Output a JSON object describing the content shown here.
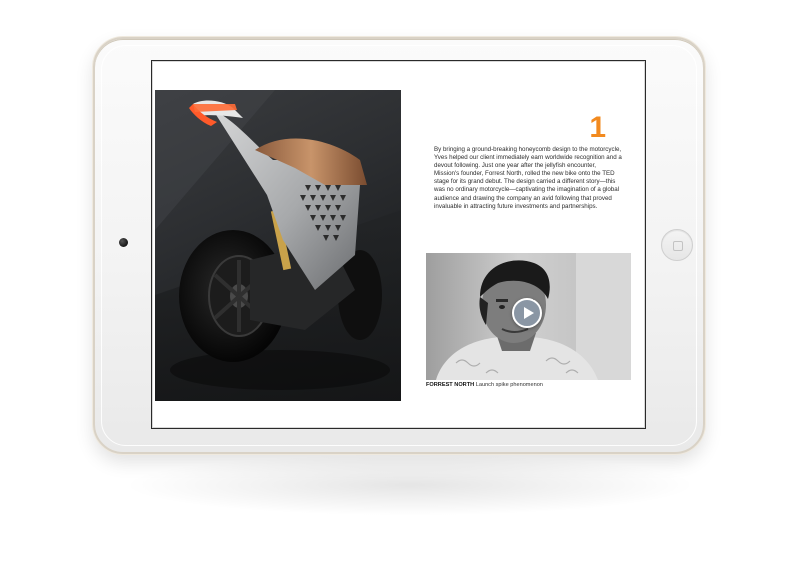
{
  "article": {
    "chapter_number": "1",
    "body_text": "By bringing a ground-breaking honeycomb design to the motorcycle, Yves helped our client immediately earn worldwide recognition and a devout following. Just one year after the jellyfish encounter, Mission's founder, Forrest North, rolled the new bike onto the TED stage for its grand debut. The design carried a different story—this was no ordinary motorcycle—captivating the imagination of a global audience and drawing the company an avid following that proved invaluable in attracting future investments and partnerships.",
    "caption": {
      "name": "FORREST NORTH",
      "text": "Launch spike phenomenon"
    }
  },
  "icons": {
    "play": "play-icon",
    "home": "home-button-icon",
    "camera": "front-camera-icon"
  },
  "colors": {
    "accent": "#f28a1f",
    "play_button": "#8a96a4",
    "device_frame": "#f3f3f3"
  }
}
